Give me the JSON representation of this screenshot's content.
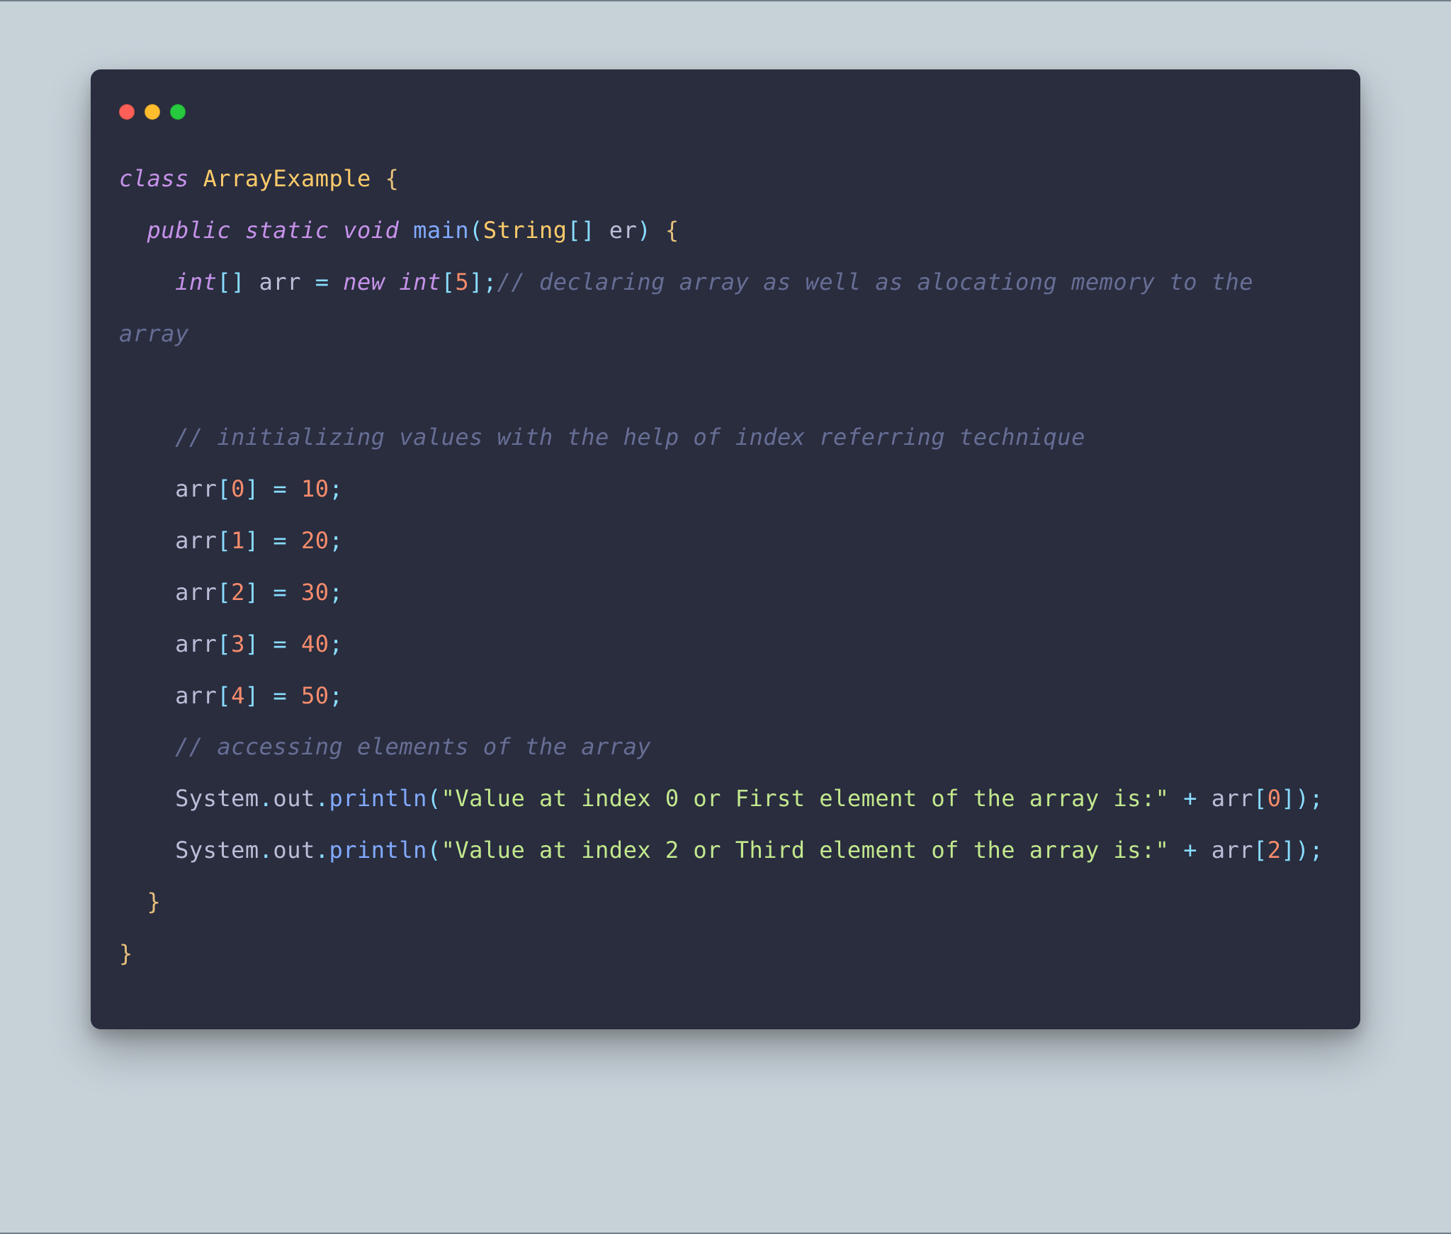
{
  "code": {
    "l1": {
      "kw_class": "class",
      "name": "ArrayExample",
      "brace": "{"
    },
    "l2": {
      "kw_public": "public",
      "kw_static": "static",
      "kw_void": "void",
      "fn": "main",
      "type": "String",
      "brackets": "[]",
      "param": "er",
      "brace": "{"
    },
    "l3": {
      "type": "int",
      "brackets": "[]",
      "var": "arr",
      "eq": "=",
      "kw_new": "new",
      "type2": "int",
      "size": "5",
      "comment": "// declaring array as well as alocationg memory to the array"
    },
    "l4": {
      "comment": "// initializing values with the help of index referring technique"
    },
    "l5": {
      "var": "arr",
      "idx": "0",
      "eq": "=",
      "val": "10"
    },
    "l6": {
      "var": "arr",
      "idx": "1",
      "eq": "=",
      "val": "20"
    },
    "l7": {
      "var": "arr",
      "idx": "2",
      "eq": "=",
      "val": "30"
    },
    "l8": {
      "var": "arr",
      "idx": "3",
      "eq": "=",
      "val": "40"
    },
    "l9": {
      "var": "arr",
      "idx": "4",
      "eq": "=",
      "val": "50"
    },
    "l10": {
      "comment": "// accessing elements of the array"
    },
    "l11": {
      "obj1": "System",
      "obj2": "out",
      "fn": "println",
      "str": "\"Value at index 0 or First element of the array is:\"",
      "plus": "+",
      "var": "arr",
      "idx": "0"
    },
    "l12": {
      "obj1": "System",
      "obj2": "out",
      "fn": "println",
      "str": "\"Value at index 2 or Third element of the array is:\"",
      "plus": "+",
      "var": "arr",
      "idx": "2"
    },
    "l13": {
      "brace": "}"
    },
    "l14": {
      "brace": "}"
    }
  }
}
